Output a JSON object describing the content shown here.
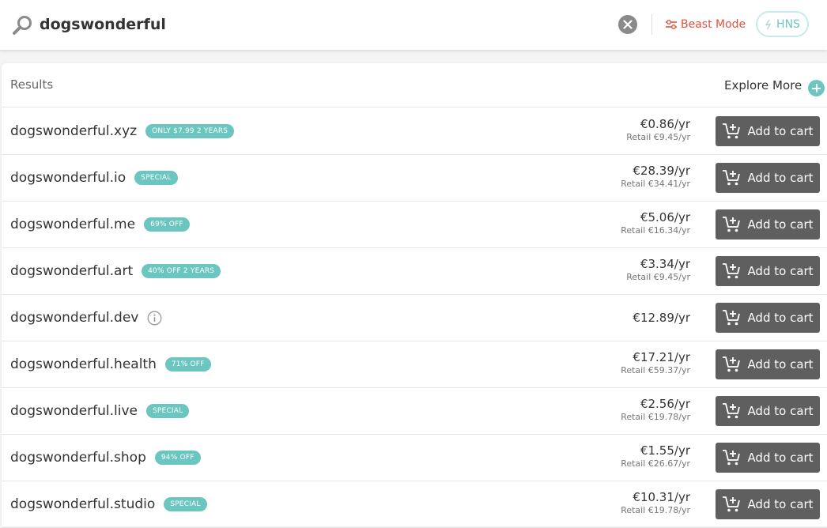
{
  "search": {
    "query": "dogswonderful",
    "beast_mode_label": "Beast Mode",
    "hns_label": "HNS"
  },
  "results": {
    "label": "Results",
    "explore_more_label": "Explore More",
    "add_to_cart_label": "Add to cart",
    "rows": [
      {
        "domain": "dogswonderful.xyz",
        "badge": "ONLY $7.99 2 YEARS",
        "price": "€0.86/yr",
        "retail": "Retail €9.45/yr"
      },
      {
        "domain": "dogswonderful.io",
        "badge": "SPECIAL",
        "price": "€28.39/yr",
        "retail": "Retail €34.41/yr"
      },
      {
        "domain": "dogswonderful.me",
        "badge": "69% OFF",
        "price": "€5.06/yr",
        "retail": "Retail €16.34/yr"
      },
      {
        "domain": "dogswonderful.art",
        "badge": "40% OFF 2 YEARS",
        "price": "€3.34/yr",
        "retail": "Retail €9.45/yr"
      },
      {
        "domain": "dogswonderful.dev",
        "badge": "",
        "info_icon": "info-icon",
        "price": "€12.89/yr",
        "retail": ""
      },
      {
        "domain": "dogswonderful.health",
        "badge": "71% OFF",
        "price": "€17.21/yr",
        "retail": "Retail €59.37/yr"
      },
      {
        "domain": "dogswonderful.live",
        "badge": "SPECIAL",
        "price": "€2.56/yr",
        "retail": "Retail €19.78/yr"
      },
      {
        "domain": "dogswonderful.shop",
        "badge": "94% OFF",
        "price": "€1.55/yr",
        "retail": "Retail €26.67/yr"
      },
      {
        "domain": "dogswonderful.studio",
        "badge": "SPECIAL",
        "price": "€10.31/yr",
        "retail": "Retail €19.78/yr"
      }
    ]
  },
  "icons": {
    "search": "search-icon",
    "clear": "close-icon",
    "beast_mode": "sliders-icon",
    "hns": "lightning-icon",
    "explore": "plus-circle-icon",
    "cart": "add-to-cart-icon"
  },
  "colors": {
    "accent_teal": "#6cc6c0",
    "beast_mode_red": "#e0533f",
    "button_gray": "#5f5f5f"
  }
}
